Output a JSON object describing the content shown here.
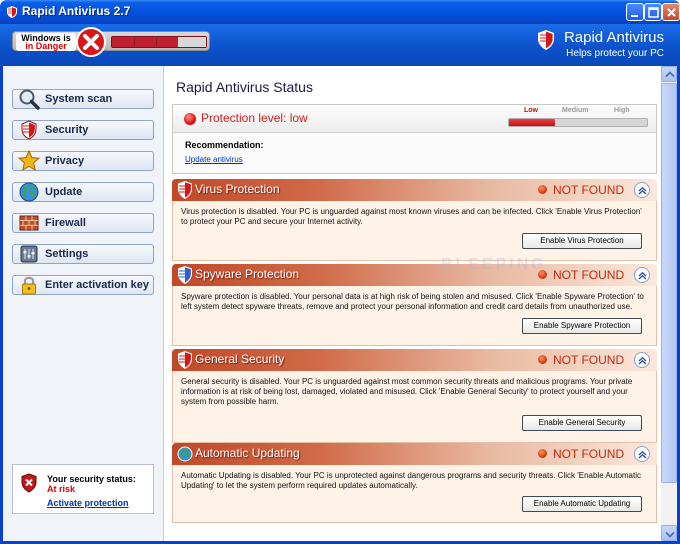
{
  "window": {
    "title": "Rapid Antivirus 2.7"
  },
  "header": {
    "danger_line1": "Windows is",
    "danger_line2": "in Danger",
    "brand_name": "Rapid Antivirus",
    "brand_tagline": "Helps protect your PC"
  },
  "sidebar": {
    "items": [
      {
        "label": "System scan",
        "icon": "magnifier-icon"
      },
      {
        "label": "Security",
        "icon": "shield-icon"
      },
      {
        "label": "Privacy",
        "icon": "star-icon"
      },
      {
        "label": "Update",
        "icon": "globe-icon"
      },
      {
        "label": "Firewall",
        "icon": "brick-wall-icon"
      },
      {
        "label": "Settings",
        "icon": "settings-icon"
      },
      {
        "label": "Enter activation key",
        "icon": "padlock-icon"
      }
    ],
    "status": {
      "label": "Your security status:",
      "value": "At risk",
      "link": "Activate protection"
    }
  },
  "main": {
    "title": "Rapid Antivirus Status",
    "protection": {
      "text": "Protection level: low",
      "meter_labels": [
        "Low",
        "Medium",
        "High"
      ],
      "level_fraction": 0.33,
      "recommendation_label": "Recommendation:",
      "recommendation_link": "Update antivirus"
    },
    "sections": [
      {
        "name": "Virus Protection",
        "status": "NOT FOUND",
        "description": "Virus protection is disabled. Your PC is unguarded against most known viruses and can be infected. Click 'Enable Virus Protection' to protect your PC and secure your Internet activity.",
        "button": "Enable Virus Protection"
      },
      {
        "name": "Spyware Protection",
        "status": "NOT FOUND",
        "description": "Spyware protection is disabled. Your personal data is at high risk of being stolen and misused. Click 'Enable Spyware Protection' to left system detect spyware threats, remove and protect your personal information and credit card details from unauthorized use.",
        "button": "Enable Spyware Protection"
      },
      {
        "name": "General Security",
        "status": "NOT FOUND",
        "description": "General security is disabled. Your PC is unguarded against most common security threats and malicious programs. Your private information is at risk of being lost, damaged, violated and misused. Click 'Enable General Security' to protect yourself and your system from possible harm.",
        "button": "Enable General Security"
      },
      {
        "name": "Automatic Updating",
        "status": "NOT FOUND",
        "description": "Automatic Updating is disabled. Your PC is unprotected against dangerous programs and security threats. Click 'Enable Automatic Updating' to let the system perform required updates automatically.",
        "button": "Enable Automatic Updating"
      }
    ]
  },
  "watermark": "BLEEPING",
  "colors": {
    "titlebar": "#0550dc",
    "alert_red": "#d02020",
    "section_header": "#c04828",
    "section_body": "#fff3e8",
    "link": "#0030c0"
  }
}
